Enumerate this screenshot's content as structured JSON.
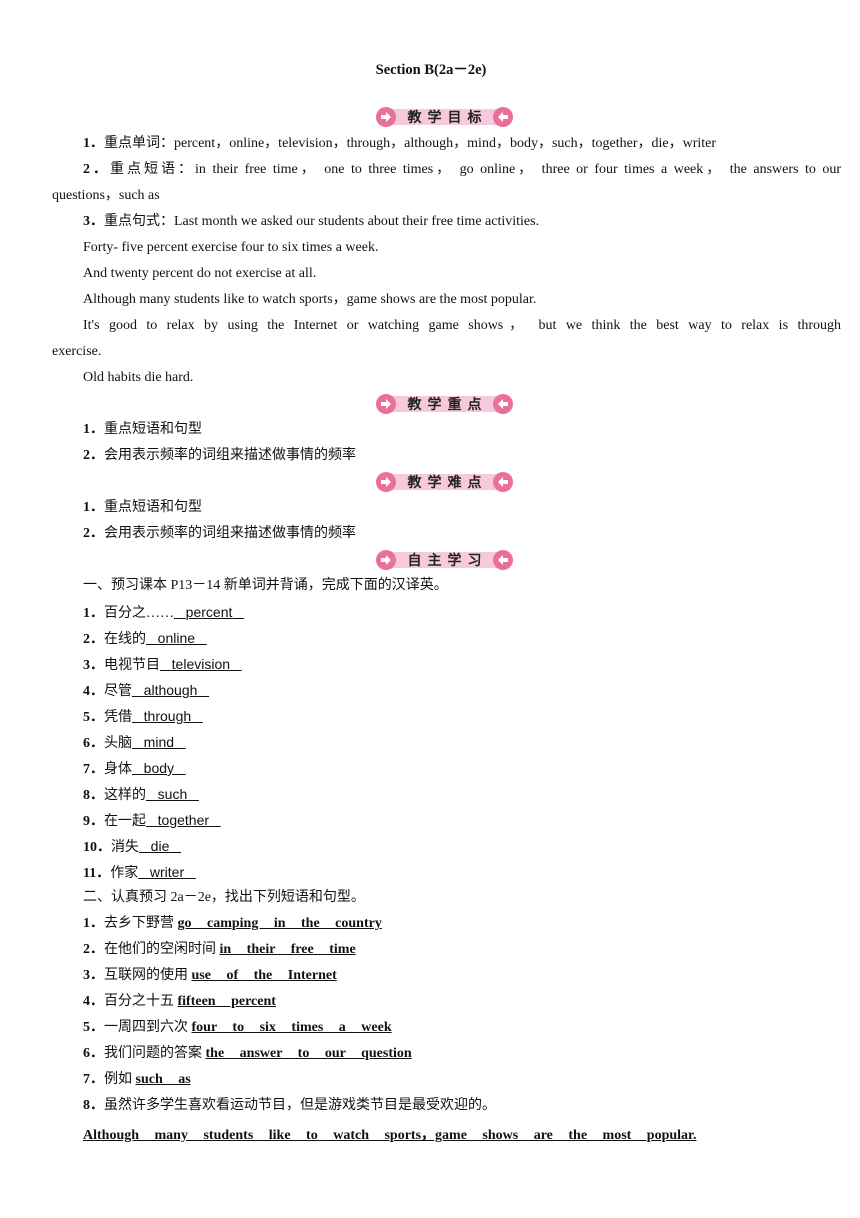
{
  "title": "Section B(2a－2e)",
  "banners": {
    "objectives": "教学目标",
    "key_points": "教学重点",
    "difficulties": "教学难点",
    "self_study": "自主学习"
  },
  "objectives": {
    "item1_num": "1．",
    "item1_label": "重点单词：",
    "item1_text": "percent，online，television，through，although，mind，body，such，together，die，writer",
    "item2_num": "2．",
    "item2_label": "重点短语：",
    "item2_text_line1": "in their free time， one to three times， go online， three or four times a week， the answers to our",
    "item2_text_line2": "questions，such as",
    "item3_num": "3．",
    "item3_label": "重点句式：",
    "item3_text": "Last month we asked our students about their free time activities.",
    "sentences": [
      "Forty- five percent exercise four to six times a week.",
      "And twenty percent do not exercise at all.",
      "Although many students like to watch sports，game shows are the most popular.",
      "It's good to relax by using the Internet or watching game shows， but we think the best way to relax is through",
      "exercise.",
      "Old habits die hard."
    ]
  },
  "key_points": [
    {
      "num": "1．",
      "text": "重点短语和句型"
    },
    {
      "num": "2．",
      "text": "会用表示频率的词组来描述做事情的频率"
    }
  ],
  "difficulties": [
    {
      "num": "1．",
      "text": "重点短语和句型"
    },
    {
      "num": "2．",
      "text": "会用表示频率的词组来描述做事情的频率"
    }
  ],
  "part1": {
    "heading": "一、预习课本 P13－14 新单词并背诵，完成下面的汉译英。",
    "items": [
      {
        "num": "1．",
        "cn": "百分之……",
        "en": "percent"
      },
      {
        "num": "2．",
        "cn": "在线的",
        "en": "online"
      },
      {
        "num": "3．",
        "cn": "电视节目",
        "en": "television"
      },
      {
        "num": "4．",
        "cn": "尽管",
        "en": "although"
      },
      {
        "num": "5．",
        "cn": "凭借",
        "en": "through"
      },
      {
        "num": "6．",
        "cn": "头脑",
        "en": "mind"
      },
      {
        "num": "7．",
        "cn": "身体",
        "en": "body"
      },
      {
        "num": "8．",
        "cn": "这样的",
        "en": "such"
      },
      {
        "num": "9．",
        "cn": "在一起",
        "en": "together"
      },
      {
        "num": "10．",
        "cn": "消失",
        "en": "die"
      },
      {
        "num": "11．",
        "cn": "作家",
        "en": "writer"
      }
    ]
  },
  "part2": {
    "heading": "二、认真预习 2a－2e，找出下列短语和句型。",
    "items": [
      {
        "num": "1．",
        "cn": "去乡下野营 ",
        "en": "go  camping  in  the  country"
      },
      {
        "num": "2．",
        "cn": "在他们的空闲时间 ",
        "en": "in  their  free  time"
      },
      {
        "num": "3．",
        "cn": "互联网的使用 ",
        "en": "use  of  the  Internet"
      },
      {
        "num": "4．",
        "cn": "百分之十五 ",
        "en": "fifteen  percent"
      },
      {
        "num": "5．",
        "cn": "一周四到六次 ",
        "en": "four  to  six  times  a  week"
      },
      {
        "num": "6．",
        "cn": "我们问题的答案 ",
        "en": "the  answer  to  our  question"
      },
      {
        "num": "7．",
        "cn": "例如 ",
        "en": "such  as"
      },
      {
        "num": "8．",
        "cn": "虽然许多学生喜欢看运动节目，但是游戏类节目是最受欢迎的。",
        "en": ""
      }
    ],
    "item8_answer": "Although many students like to watch sports，game shows are the most popular."
  },
  "colors": {
    "banner_bg": "#f6c9dc",
    "banner_arrow": "#ea6f9b"
  }
}
